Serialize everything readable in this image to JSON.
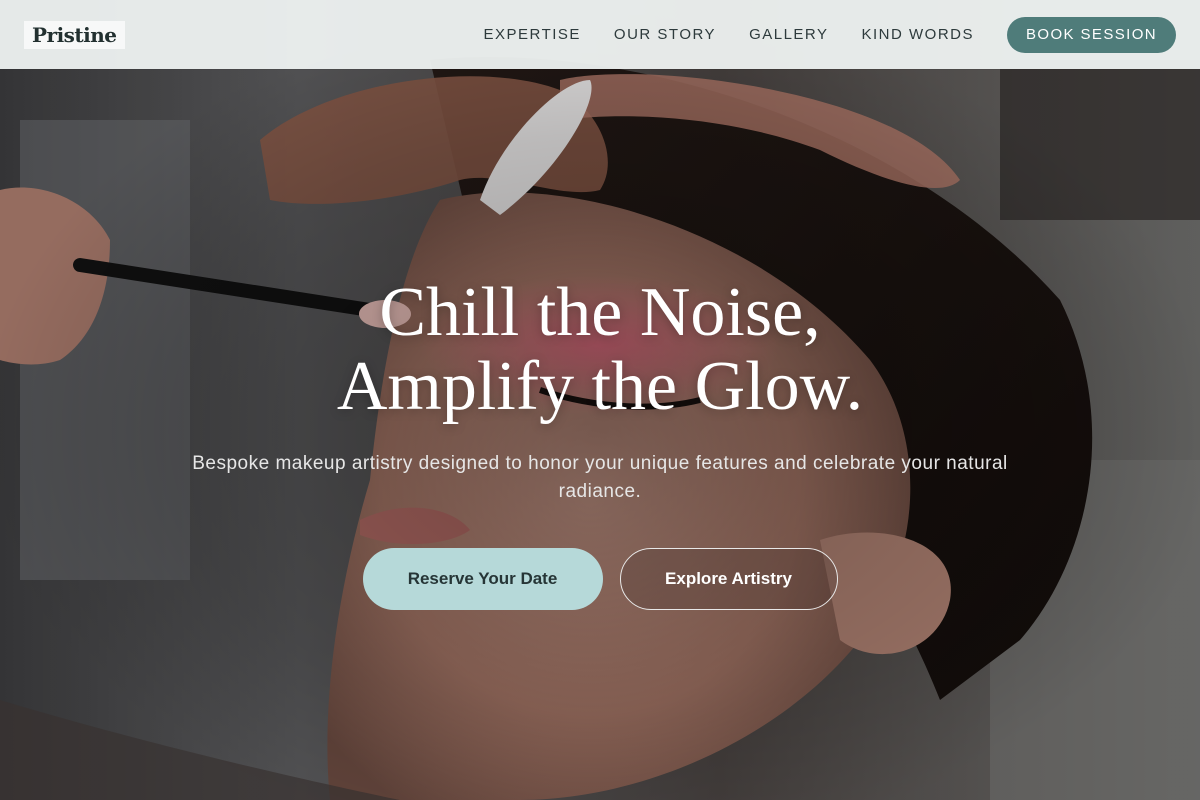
{
  "brand": {
    "logo_text": "Pristine"
  },
  "nav": {
    "items": [
      {
        "label": "EXPERTISE"
      },
      {
        "label": "OUR STORY"
      },
      {
        "label": "GALLERY"
      },
      {
        "label": "KIND WORDS"
      }
    ],
    "cta_label": "BOOK SESSION"
  },
  "hero": {
    "headline_line1": "Chill the Noise,",
    "headline_line2": "Amplify the Glow.",
    "subtext": "Bespoke makeup artistry designed to honor your unique features and celebrate your natural radiance.",
    "primary_cta": "Reserve Your Date",
    "secondary_cta": "Explore Artistry",
    "background_image": "makeup-artist-applying-eyeshadow-photo"
  },
  "colors": {
    "accent": "#4f7c7a",
    "primary_cta_bg": "#b6d9d9",
    "header_bg": "#f0f4f3",
    "text_dark": "#2d3a3c"
  }
}
